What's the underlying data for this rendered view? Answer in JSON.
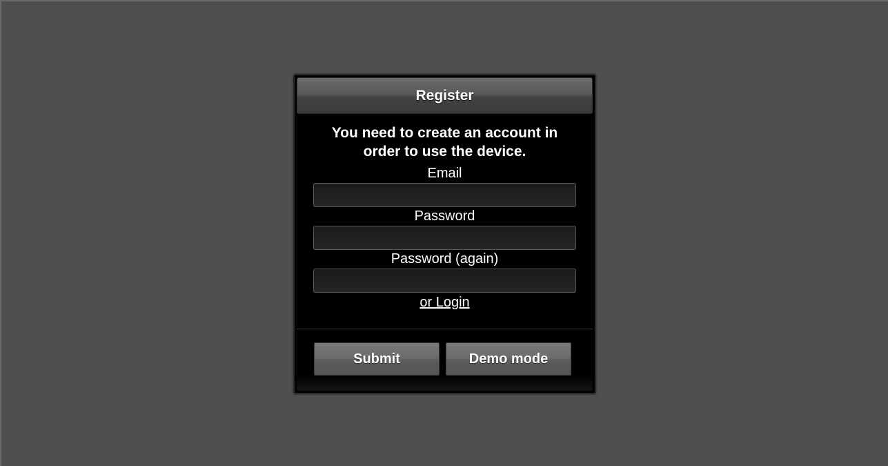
{
  "dialog": {
    "title": "Register",
    "intro": "You need to create an account in order to use the device.",
    "fields": {
      "email_label": "Email",
      "email_value": "",
      "password_label": "Password",
      "password_value": "",
      "password_again_label": "Password (again)",
      "password_again_value": ""
    },
    "login_link": "or Login",
    "buttons": {
      "submit": "Submit",
      "demo": "Demo mode"
    }
  },
  "colors": {
    "page_background": "#4f4f4f",
    "dialog_background": "#000000",
    "text": "#ffffff"
  }
}
